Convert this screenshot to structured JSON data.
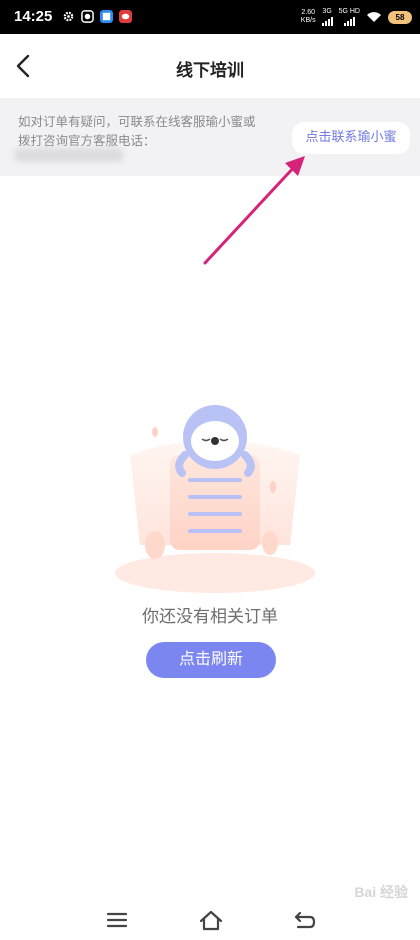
{
  "status_bar": {
    "time": "14:25",
    "net_speed_value": "2.60",
    "net_speed_unit": "KB/s",
    "sig1_label": "3G",
    "sig2_label": "5G HD",
    "battery": "58"
  },
  "header": {
    "title": "线下培训"
  },
  "notice": {
    "text": "如对订单有疑问，可联系在线客服瑜小蜜或拨打咨询官方客服电话：",
    "contact_button": "点击联系瑜小蜜"
  },
  "empty_state": {
    "message": "你还没有相关订单",
    "refresh_button": "点击刷新"
  },
  "watermark": "Bai 经验",
  "colors": {
    "accent": "#7b86f0",
    "link": "#6f79e0",
    "arrow": "#d6237a",
    "notice_bg": "#f2f2f4"
  },
  "icons": {
    "back": "chevron-left-icon",
    "menu": "menu-icon",
    "home": "home-icon",
    "back_nav": "back-nav-icon"
  }
}
